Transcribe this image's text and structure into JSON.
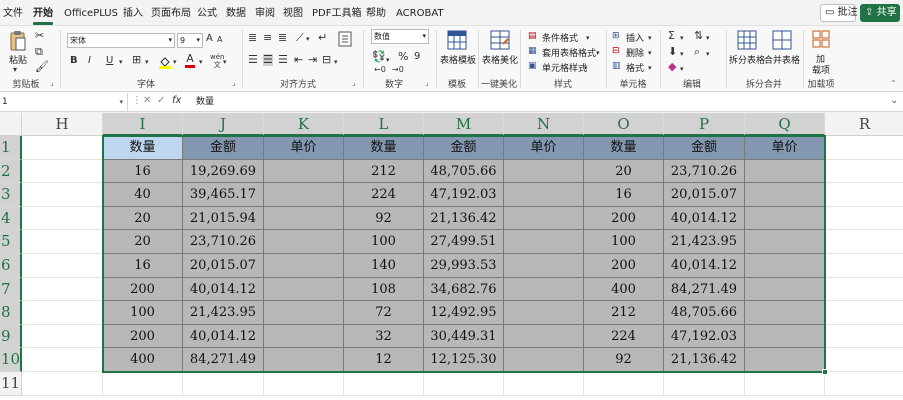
{
  "menu": {
    "tabs": [
      "文件",
      "开始",
      "OfficePLUS",
      "插入",
      "页面布局",
      "公式",
      "数据",
      "审阅",
      "视图",
      "PDF工具箱",
      "帮助",
      "ACROBAT"
    ],
    "active": "开始",
    "comment_label": "批注",
    "share_label": "共享"
  },
  "ribbon": {
    "clipboard": {
      "paste": "粘贴",
      "label": "剪贴板"
    },
    "font": {
      "name": "宋体",
      "size": "9",
      "bold": "B",
      "italic": "I",
      "underline": "U",
      "font_color_letter": "A",
      "increase": "A",
      "decrease": "A",
      "wen": "wén",
      "label": "字体"
    },
    "alignment": {
      "label": "对齐方式"
    },
    "number": {
      "format": "数值",
      "percent": "%",
      "comma": "9",
      "label": "数字"
    },
    "template": {
      "table_template": "表格模板",
      "label": "模板"
    },
    "beautify": {
      "beautify": "表格美化",
      "label": "一键美化"
    },
    "styles": {
      "conditional": "条件格式",
      "table_format": "套用表格格式",
      "cell_styles": "单元格样式",
      "label": "样式"
    },
    "cells": {
      "insert": "插入",
      "delete": "删除",
      "format": "格式",
      "label": "单元格"
    },
    "editing": {
      "sum": "Σ",
      "label": "编辑"
    },
    "split": {
      "split_table": "拆分表格",
      "merge_table": "合并表格",
      "label": "拆分合并"
    },
    "addins": {
      "addin_line1": "加",
      "addin_line2": "载项",
      "label": "加载项"
    }
  },
  "formula_bar": {
    "name_box": "1",
    "cancel": "✕",
    "confirm": "✓",
    "fx": "fx",
    "formula": "数量"
  },
  "grid": {
    "columns": [
      "H",
      "I",
      "J",
      "K",
      "L",
      "M",
      "N",
      "O",
      "P",
      "Q",
      "R"
    ],
    "rows": [
      "1",
      "2",
      "3",
      "4",
      "5",
      "6",
      "7",
      "8",
      "9",
      "10",
      "11"
    ],
    "table_headers": [
      "数量",
      "金额",
      "单价",
      "数量",
      "金额",
      "单价",
      "数量",
      "金额",
      "单价"
    ],
    "table_rows": [
      [
        "16",
        "19,269.69",
        "",
        "212",
        "48,705.66",
        "",
        "20",
        "23,710.26",
        ""
      ],
      [
        "40",
        "39,465.17",
        "",
        "224",
        "47,192.03",
        "",
        "16",
        "20,015.07",
        ""
      ],
      [
        "20",
        "21,015.94",
        "",
        "92",
        "21,136.42",
        "",
        "200",
        "40,014.12",
        ""
      ],
      [
        "20",
        "23,710.26",
        "",
        "100",
        "27,499.51",
        "",
        "100",
        "21,423.95",
        ""
      ],
      [
        "16",
        "20,015.07",
        "",
        "140",
        "29,993.53",
        "",
        "200",
        "40,014.12",
        ""
      ],
      [
        "200",
        "40,014.12",
        "",
        "108",
        "34,682.76",
        "",
        "400",
        "84,271.49",
        ""
      ],
      [
        "100",
        "21,423.95",
        "",
        "72",
        "12,492.95",
        "",
        "212",
        "48,705.66",
        ""
      ],
      [
        "200",
        "40,014.12",
        "",
        "32",
        "30,449.31",
        "",
        "224",
        "47,192.03",
        ""
      ],
      [
        "400",
        "84,271.49",
        "",
        "12",
        "12,125.30",
        "",
        "92",
        "21,136.42",
        ""
      ]
    ]
  },
  "colors": {
    "accent": "#217346",
    "header_fill": "#8497b0",
    "active_header_fill": "#bdd7ee",
    "body_fill": "#b8b8b8"
  }
}
